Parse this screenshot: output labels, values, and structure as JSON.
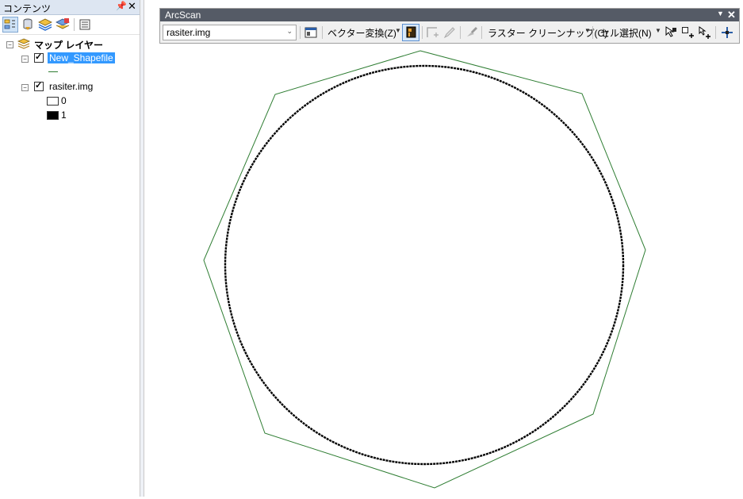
{
  "toc": {
    "title": "コンテンツ",
    "pin_glyph": "ꟼ",
    "close_glyph": "✕",
    "tree": {
      "root_label": "マップ レイヤー",
      "layers": [
        {
          "name": "New_Shapefile",
          "checked": true,
          "selected": true
        },
        {
          "name": "rasiter.img",
          "checked": true,
          "selected": false,
          "legend": [
            {
              "label": "0",
              "color": "#ffffff"
            },
            {
              "label": "1",
              "color": "#000000"
            }
          ]
        }
      ]
    }
  },
  "arcscan": {
    "title": "ArcScan",
    "close_glyph": "✕",
    "layer_value": "rasiter.img",
    "vectorize_menu": "ベクター変換(Z)",
    "raster_cleanup_menu": "ラスター クリーンナップ(C)",
    "cell_select_menu": "セル選択(N)"
  },
  "colors": {
    "polygon_stroke": "#2e7d32",
    "circle_stroke": "#000000",
    "selection": "#3399ff",
    "toolbar_title_bg": "#555b66"
  }
}
